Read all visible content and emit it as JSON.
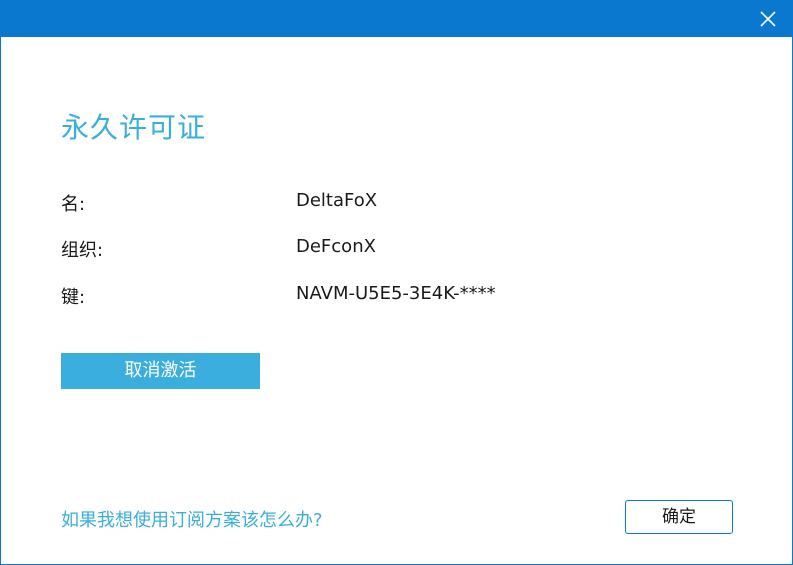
{
  "window": {
    "accent_color": "#0b78d0",
    "close_icon": "close-icon"
  },
  "dialog": {
    "title": "永久许可证",
    "title_color": "#3aaedc"
  },
  "license": {
    "rows": [
      {
        "label": "名:",
        "value": "DeltaFoX"
      },
      {
        "label": "组织:",
        "value": "DeFconX"
      },
      {
        "label": "键:",
        "value": "NAVM-U5E5-3E4K-****"
      }
    ]
  },
  "actions": {
    "deactivate_label": "取消激活",
    "deactivate_color": "#3aaedc",
    "subscription_link": "如果我想使用订阅方案该怎么办?",
    "ok_label": "确定"
  }
}
